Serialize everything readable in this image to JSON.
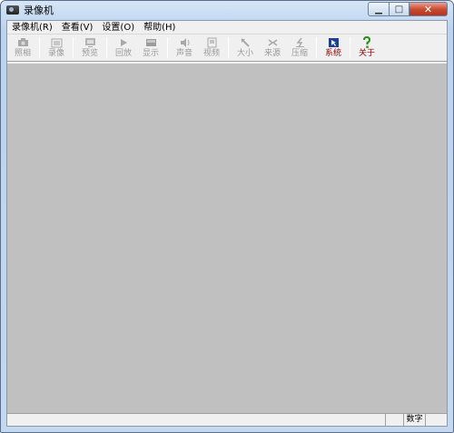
{
  "window": {
    "title": "录像机"
  },
  "menu": [
    "录像机(R)",
    "查看(V)",
    "设置(O)",
    "帮助(H)"
  ],
  "toolbar": {
    "buttons": [
      {
        "label": "照相",
        "icon": "camera-icon",
        "enabled": false
      },
      {
        "label": "录像",
        "icon": "film-icon",
        "enabled": false
      },
      {
        "label": "预览",
        "icon": "preview-icon",
        "enabled": false
      },
      {
        "label": "回放",
        "icon": "play-icon",
        "enabled": false
      },
      {
        "label": "显示",
        "icon": "display-icon",
        "enabled": false
      },
      {
        "label": "声音",
        "icon": "speaker-icon",
        "enabled": false
      },
      {
        "label": "视频",
        "icon": "video-icon",
        "enabled": false
      },
      {
        "label": "大小",
        "icon": "resize-icon",
        "enabled": false
      },
      {
        "label": "来源",
        "icon": "source-icon",
        "enabled": false
      },
      {
        "label": "压缩",
        "icon": "compress-icon",
        "enabled": false
      },
      {
        "label": "系统",
        "icon": "system-icon",
        "enabled": true
      },
      {
        "label": "关于",
        "icon": "about-icon",
        "enabled": true
      }
    ]
  },
  "status": {
    "numlock": "数字"
  },
  "colors": {
    "canvas": "#c0c0c0",
    "active_label": "#8b0000"
  }
}
